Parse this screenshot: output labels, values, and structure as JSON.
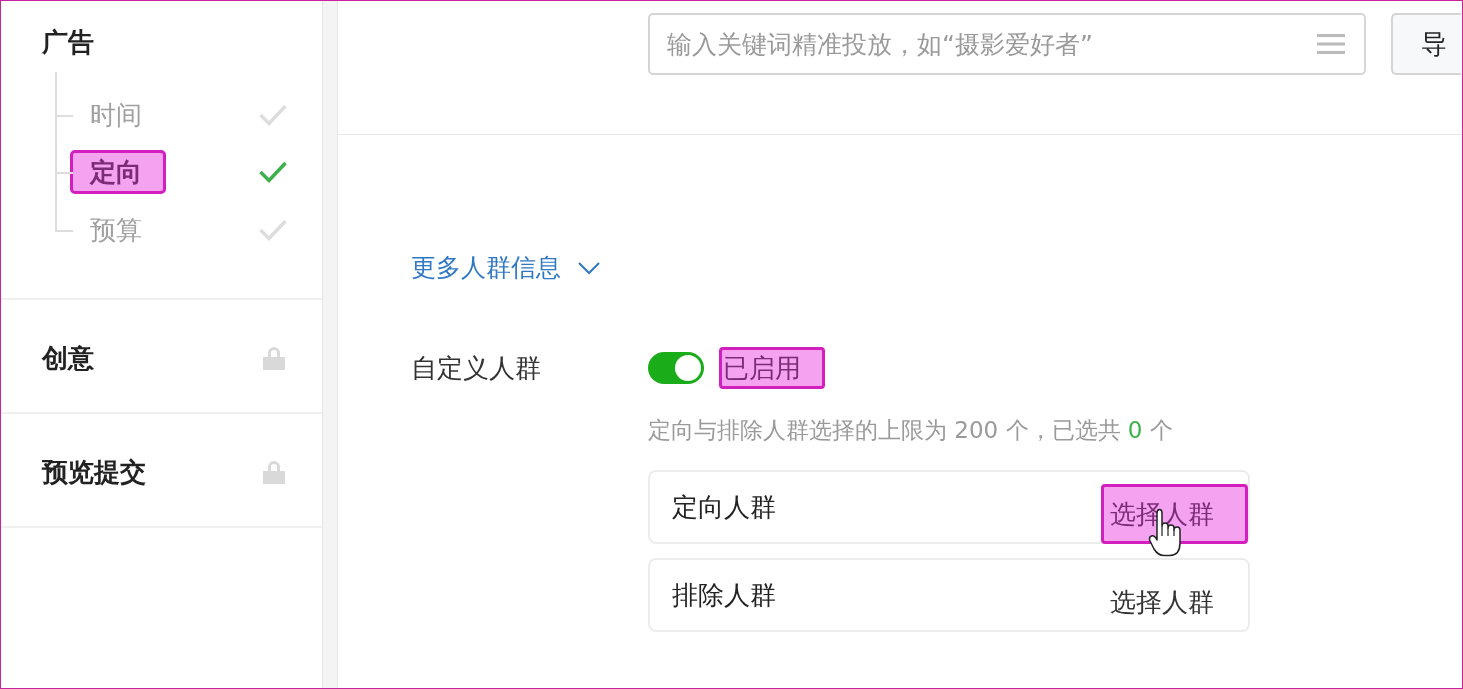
{
  "sidebar": {
    "sections": [
      {
        "title": "广告",
        "locked": false,
        "steps": [
          {
            "label": "时间",
            "selected": false,
            "highlighted": false
          },
          {
            "label": "定向",
            "selected": true,
            "highlighted": true
          },
          {
            "label": "预算",
            "selected": false,
            "highlighted": false
          }
        ]
      },
      {
        "title": "创意",
        "locked": true
      },
      {
        "title": "预览提交",
        "locked": true
      }
    ]
  },
  "keyword_search": {
    "placeholder": "输入关键词精准投放，如“摄影爱好者”"
  },
  "import_button": {
    "label": "导"
  },
  "more_info_link": {
    "label": "更多人群信息",
    "expanded": false
  },
  "custom_audience": {
    "label": "自定义人群",
    "switch": {
      "on": true
    },
    "status": {
      "label": "已启用",
      "highlighted": true
    },
    "hint": {
      "before": "定向与排除人群选择的上限为 200 个，已选共 ",
      "count": "0",
      "after": " 个"
    },
    "rows": [
      {
        "label": "定向人群",
        "button": {
          "label": "选择人群",
          "highlighted": true,
          "hovered": true
        }
      },
      {
        "label": "排除人群",
        "button": {
          "label": "选择人群",
          "highlighted": false,
          "hovered": false
        }
      }
    ]
  }
}
